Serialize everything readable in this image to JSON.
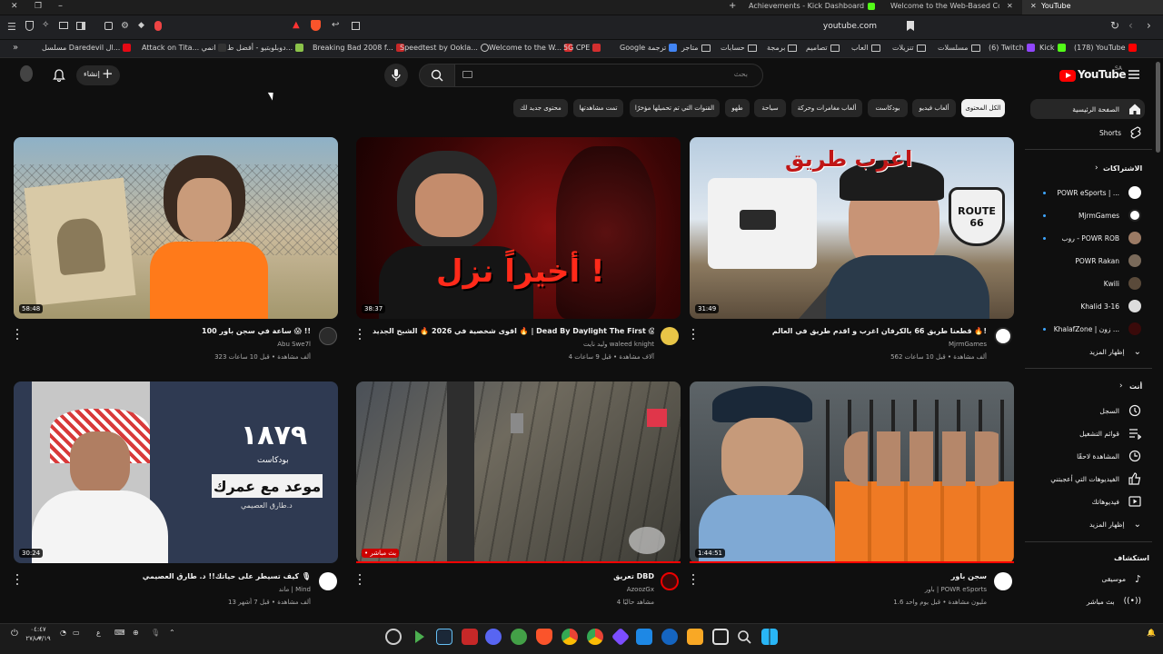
{
  "browser": {
    "tabs": [
      {
        "label": "Achievements - Kick Dashboard"
      },
      {
        "label": "Welcome to the Web-Based Config"
      },
      {
        "label": "YouTube"
      }
    ],
    "address": "youtube.com",
    "bookmarks": [
      {
        "label": "مسلسل Daredevil ال..."
      },
      {
        "label": "Attack on Tita... انمي"
      },
      {
        "label": "دوبلوبتيو - أفضل ط..."
      },
      {
        "label": "Breaking Bad 2008 f..."
      },
      {
        "label": "Speedtest by Ookla..."
      },
      {
        "label": "Welcome to the W..."
      },
      {
        "label": "5G CPE"
      },
      {
        "label": "Google ترجمة"
      },
      {
        "label": "متاجر"
      },
      {
        "label": "حسابات"
      },
      {
        "label": "برمجة"
      },
      {
        "label": "تصاميم"
      },
      {
        "label": "العاب"
      },
      {
        "label": "تنزيلات"
      },
      {
        "label": "مسلسلات"
      },
      {
        "label": "(6) Twitch"
      },
      {
        "label": "Kick"
      },
      {
        "label": "(178) YouTube"
      }
    ]
  },
  "header": {
    "create_label": "إنشاء",
    "search_placeholder": "بحث",
    "logo_text": "YouTube",
    "logo_region": "SA"
  },
  "chips": [
    {
      "label": "الكل المحتوى",
      "active": true
    },
    {
      "label": "ألعاب فيديو"
    },
    {
      "label": "بودكاست"
    },
    {
      "label": "ألعاب مغامرات وحركة"
    },
    {
      "label": "سياحة"
    },
    {
      "label": "طهو"
    },
    {
      "label": "القنوات التي تم تحميلها مؤخرًا"
    },
    {
      "label": "تمت مشاهدتها"
    },
    {
      "label": "محتوى جديد لك"
    }
  ],
  "videos": [
    {
      "title": "100 ساعة في سجن باور 😱 !!",
      "channel": "Abu Swe7l",
      "meta": "323 ألف مشاهدة • قبل 10 ساعات",
      "duration": "58:48"
    },
    {
      "title": "اقوى شخصية في 2026 🔥 الشبح الجديد 🔥 | Dead By Daylight The First 😱",
      "channel": "وليد نايت waleed knight",
      "meta": "4 آلاف مشاهدة • قبل 9 ساعات",
      "duration": "38:37",
      "overlay": "أخيراً نزل !"
    },
    {
      "title": "قطعنا طريق 66 بالكرفان اغرب و اقدم طريق في العالم 🔥!",
      "channel": "MjrmGames",
      "meta": "562 ألف مشاهدة • قبل 10 ساعات",
      "duration": "31:49",
      "overlay": "اغرب طريق",
      "sign": "ROUTE 66"
    },
    {
      "title": "كيف تسيطر على حياتك!! د. طارق العصيمي 🎙",
      "channel": "ماند | Mind",
      "meta": "13 ألف مشاهدة • قبل 7 أشهر",
      "duration": "30:24",
      "overlay_num": "١٨٧٩",
      "overlay_sub": "بودكاست",
      "overlay_box": "موعد مع عمرك",
      "overlay_name": "د.طارق العصيمي"
    },
    {
      "title": "تعريق DBD",
      "channel": "AzoozGx",
      "meta": "4 مشاهد حاليًا",
      "duration": "• بث مباشر",
      "live": true
    },
    {
      "title": "سجن باور",
      "channel": "باور | POWR eSports",
      "meta": "1.6 مليون مشاهدة • قبل يوم واحد",
      "duration": "1:44:51"
    }
  ],
  "sidebar": {
    "home": "الصفحة الرئيسية",
    "shorts": "Shorts",
    "subs_heading": "الاشتراكات",
    "subscriptions": [
      {
        "name": "POWR eSports | ...",
        "dot": true
      },
      {
        "name": "MjrmGames",
        "dot": true
      },
      {
        "name": "روب - POWR ROB",
        "dot": true
      },
      {
        "name": "POWR Rakan"
      },
      {
        "name": "Kwili"
      },
      {
        "name": "Khalid 3-16"
      },
      {
        "name": "KhalafZone | زون ...",
        "dot": true
      }
    ],
    "show_more": "إظهار المزيد",
    "you_heading": "أنت",
    "you_items": [
      {
        "label": "السجل"
      },
      {
        "label": "قوائم التشغيل"
      },
      {
        "label": "المشاهدة لاحقًا"
      },
      {
        "label": "الفيديوهات التي أعجبتني"
      },
      {
        "label": "فيديوهاتك"
      },
      {
        "label": "إظهار المزيد"
      }
    ],
    "explore_heading": "استكشاف",
    "explore_items": [
      {
        "label": "موسيقى"
      },
      {
        "label": "بث مباشر"
      }
    ]
  },
  "taskbar": {
    "time": "٠٤:٤٧ ص",
    "date": "٢٧/٠٧/١٩"
  },
  "colors": {
    "bg": "#0f0f0f",
    "accent_red": "#ff0000",
    "link_blue": "#3ea6ff"
  }
}
